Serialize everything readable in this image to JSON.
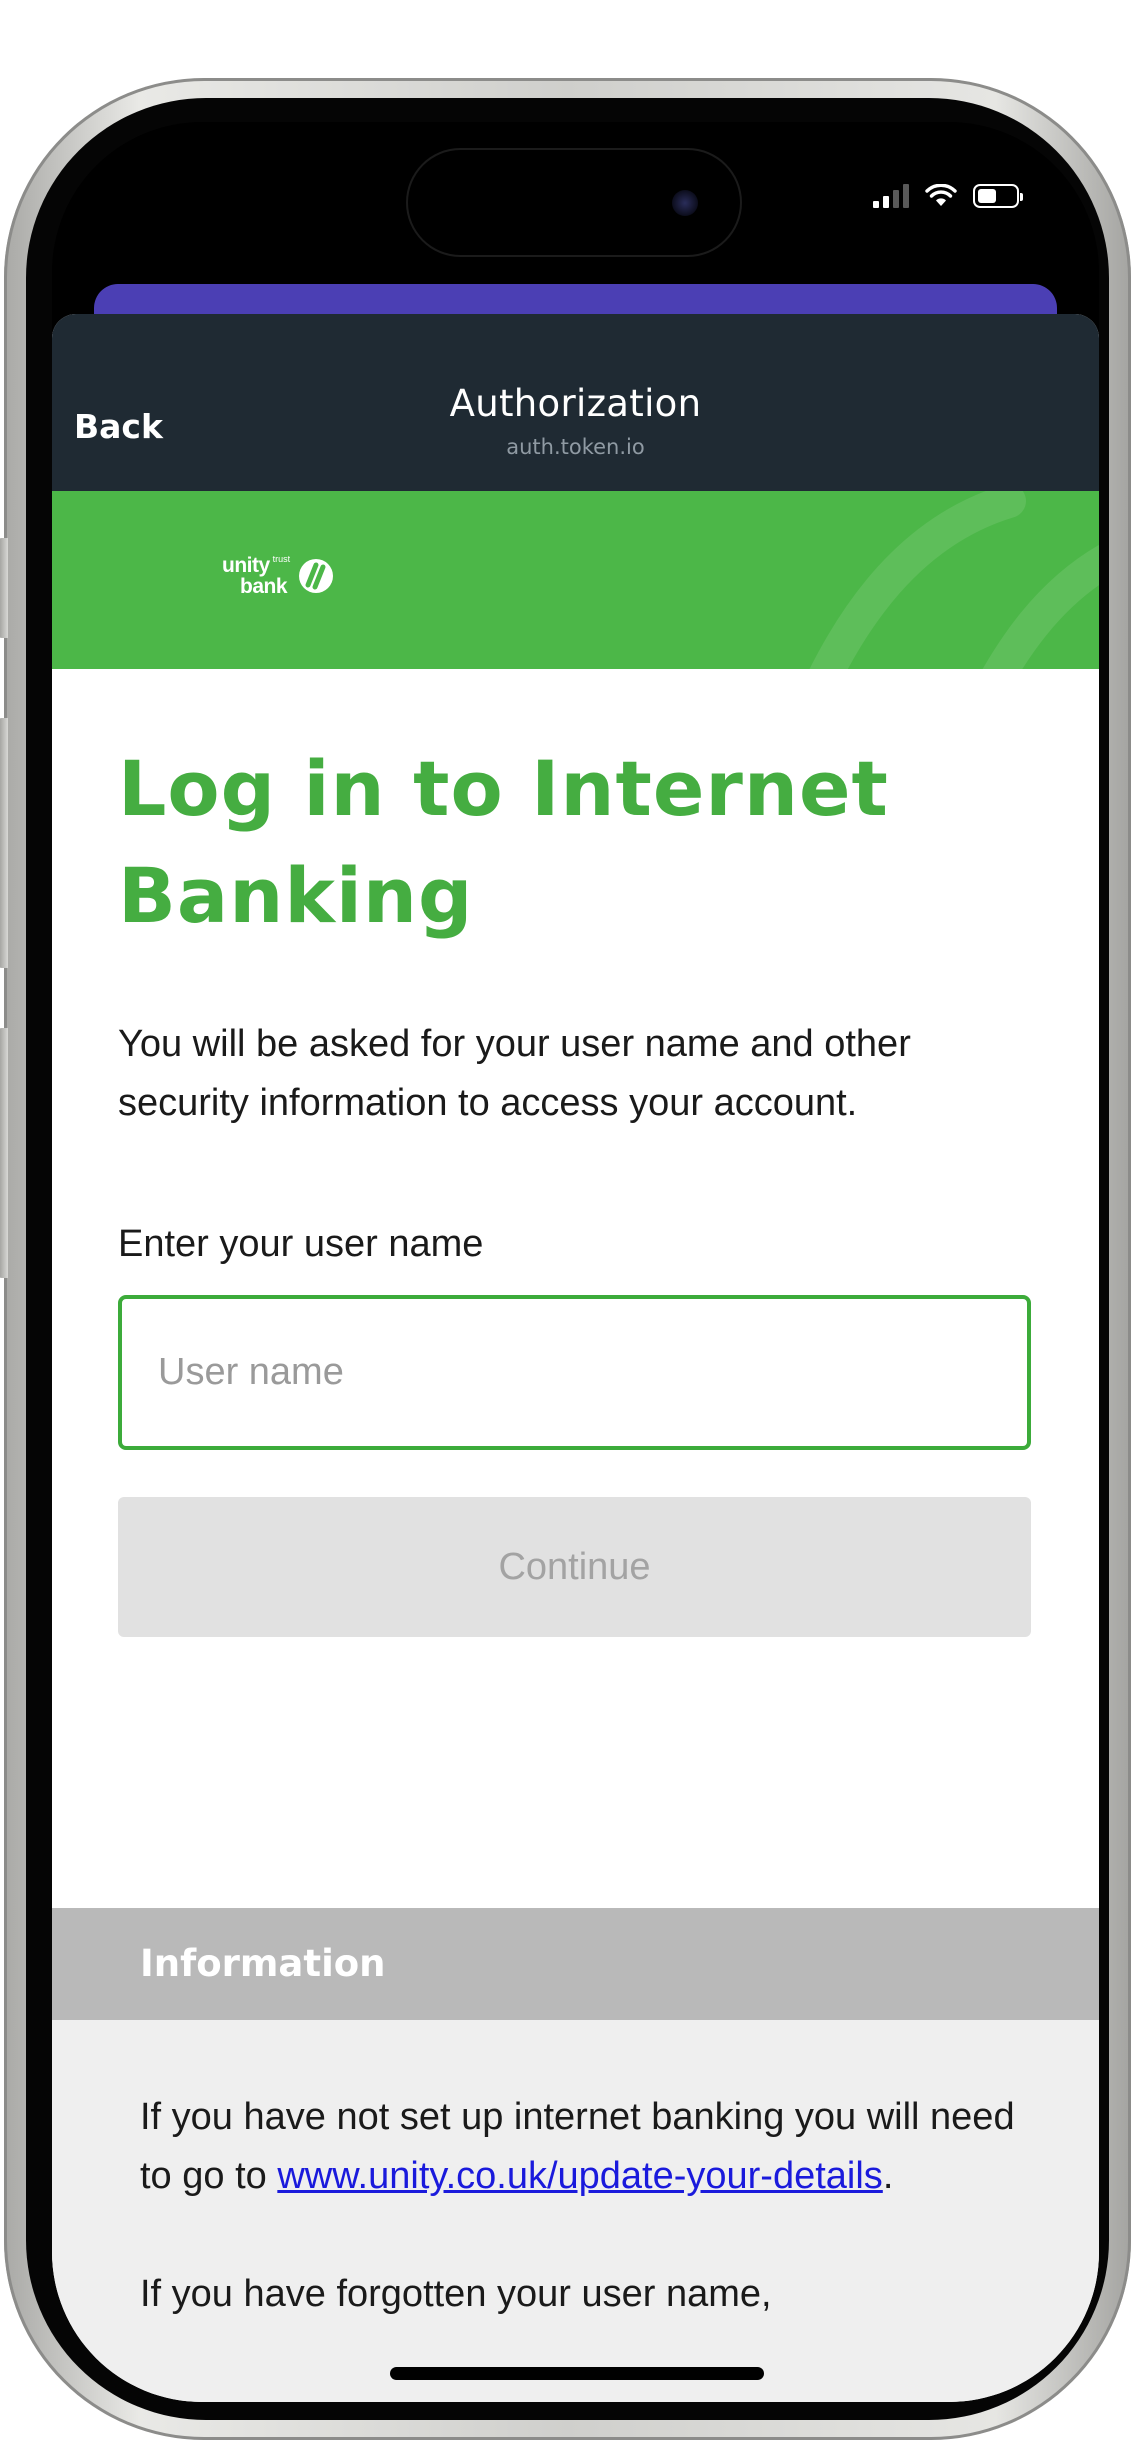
{
  "status_bar": {
    "signal_icon": "cellular-signal-icon",
    "wifi_icon": "wifi-icon",
    "battery_icon": "battery-icon"
  },
  "nav": {
    "back_label": "Back",
    "title": "Authorization",
    "subtitle": "auth.token.io"
  },
  "bank": {
    "logo_name": "unity",
    "logo_trust": "trust",
    "logo_bank": "bank",
    "brand_color": "#4cb748"
  },
  "main": {
    "title": "Log in to Internet Banking",
    "intro": "You will be asked for your user name and other security information to access your account.",
    "username_label": "Enter your user name",
    "username_placeholder": "User name",
    "username_value": "",
    "continue_label": "Continue"
  },
  "info": {
    "header": "Information",
    "p1_before": "If you have not set up internet banking you will need to go to ",
    "p1_link": "www.unity.co.uk/update-your-details",
    "p1_after": ".",
    "p2": "If you have forgotten your user name,"
  },
  "colors": {
    "title_green": "#45ad41",
    "nav_dark": "#1f2a33",
    "link_blue": "#1a1adc",
    "sheet_purple": "#4b3fb4"
  }
}
